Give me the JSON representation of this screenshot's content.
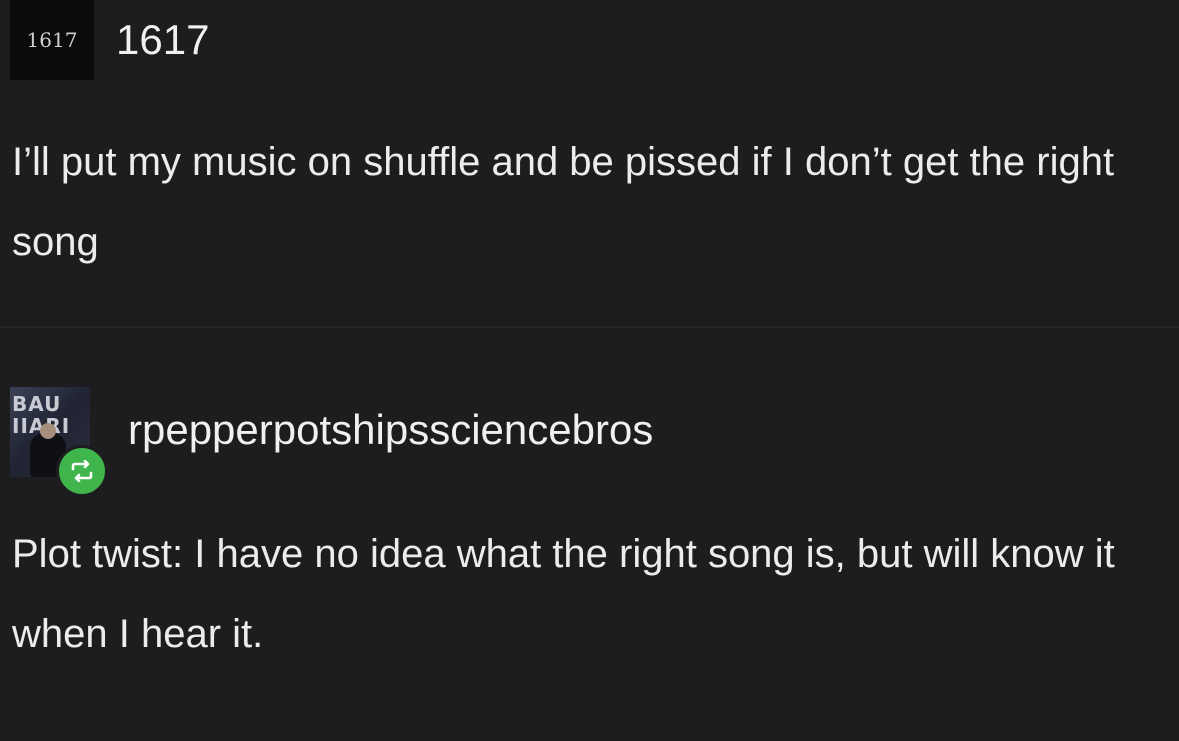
{
  "post": {
    "avatar_text": "1617",
    "username": "1617",
    "body": "I’ll put my music on shuffle and be pissed if I don’t get the right song"
  },
  "reblog": {
    "avatar_letters_line1": "BAU",
    "avatar_letters_line2": "IIARI",
    "username": "rpepperpotshipssciencebros",
    "body": "Plot twist: I have no idea what the right song is, but will know it when I hear it.",
    "badge_icon": "reblog-icon",
    "badge_color": "#3fb54b"
  }
}
